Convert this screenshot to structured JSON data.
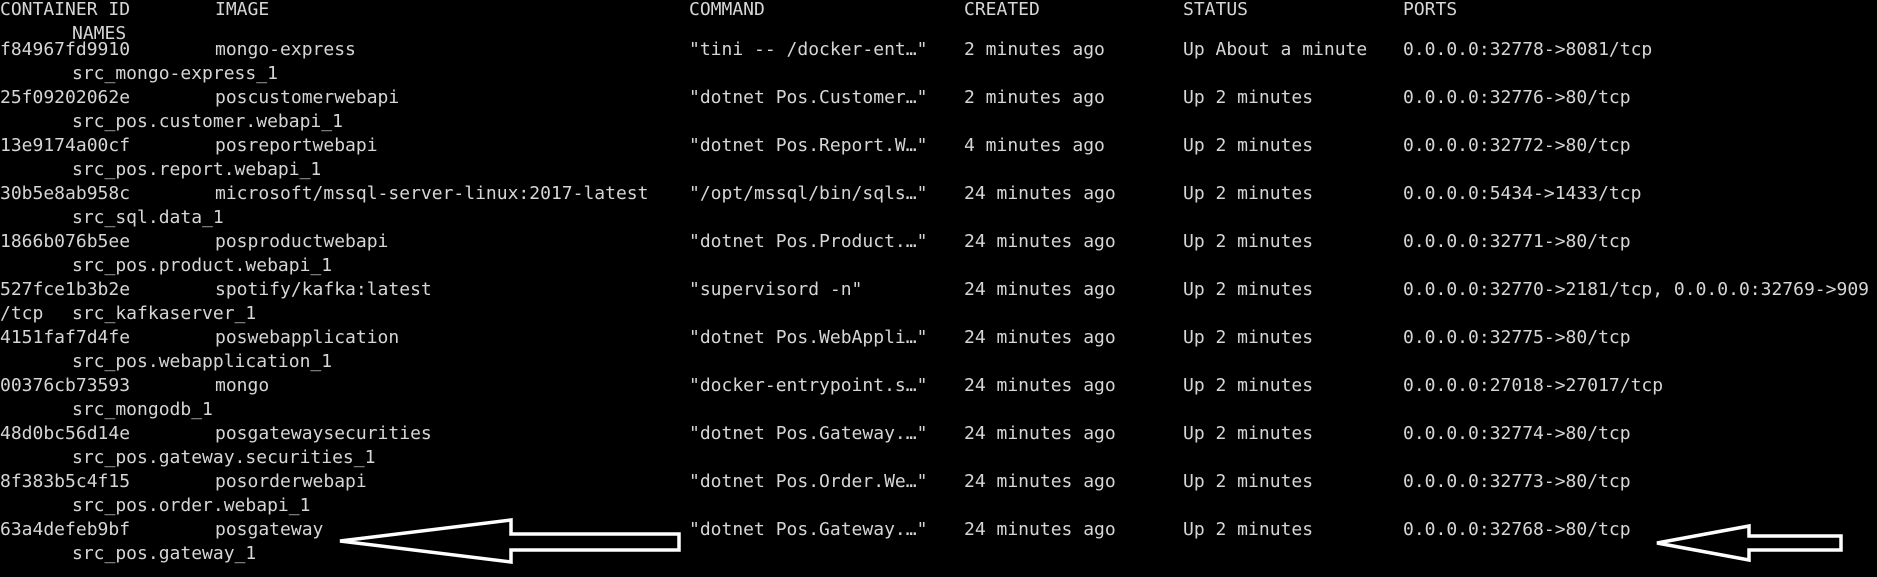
{
  "terminal": {
    "header": {
      "container_id": "CONTAINER ID",
      "image": "IMAGE",
      "command": "COMMAND",
      "created": "CREATED",
      "status": "STATUS",
      "ports": "PORTS",
      "names": "NAMES"
    },
    "rows": [
      {
        "id": "f84967fd9910",
        "image": "mongo-express",
        "command": "\"tini -- /docker-ent…\"",
        "created": "2 minutes ago",
        "status": "Up About a minute",
        "ports": "0.0.0.0:32778->8081/tcp",
        "name": "src_mongo-express_1"
      },
      {
        "id": "25f09202062e",
        "image": "poscustomerwebapi",
        "command": "\"dotnet Pos.Customer…\"",
        "created": "2 minutes ago",
        "status": "Up 2 minutes",
        "ports": "0.0.0.0:32776->80/tcp",
        "name": "src_pos.customer.webapi_1"
      },
      {
        "id": "13e9174a00cf",
        "image": "posreportwebapi",
        "command": "\"dotnet Pos.Report.W…\"",
        "created": "4 minutes ago",
        "status": "Up 2 minutes",
        "ports": "0.0.0.0:32772->80/tcp",
        "name": "src_pos.report.webapi_1"
      },
      {
        "id": "30b5e8ab958c",
        "image": "microsoft/mssql-server-linux:2017-latest",
        "command": "\"/opt/mssql/bin/sqls…\"",
        "created": "24 minutes ago",
        "status": "Up 2 minutes",
        "ports": "0.0.0.0:5434->1433/tcp",
        "name": "src_sql.data_1"
      },
      {
        "id": "1866b076b5ee",
        "image": "posproductwebapi",
        "command": "\"dotnet Pos.Product.…\"",
        "created": "24 minutes ago",
        "status": "Up 2 minutes",
        "ports": "0.0.0.0:32771->80/tcp",
        "name": "src_pos.product.webapi_1"
      },
      {
        "id": "527fce1b3b2e",
        "image": "spotify/kafka:latest",
        "command": "\"supervisord -n\"",
        "created": "24 minutes ago",
        "status": "Up 2 minutes",
        "ports": "0.0.0.0:32770->2181/tcp, 0.0.0.0:32769->909",
        "tail": "/tcp",
        "name": "src_kafkaserver_1"
      },
      {
        "id": "4151faf7d4fe",
        "image": "poswebapplication",
        "command": "\"dotnet Pos.WebAppli…\"",
        "created": "24 minutes ago",
        "status": "Up 2 minutes",
        "ports": "0.0.0.0:32775->80/tcp",
        "name": "src_pos.webapplication_1"
      },
      {
        "id": "00376cb73593",
        "image": "mongo",
        "command": "\"docker-entrypoint.s…\"",
        "created": "24 minutes ago",
        "status": "Up 2 minutes",
        "ports": "0.0.0.0:27018->27017/tcp",
        "name": "src_mongodb_1"
      },
      {
        "id": "48d0bc56d14e",
        "image": "posgatewaysecurities",
        "command": "\"dotnet Pos.Gateway.…\"",
        "created": "24 minutes ago",
        "status": "Up 2 minutes",
        "ports": "0.0.0.0:32774->80/tcp",
        "name": "src_pos.gateway.securities_1"
      },
      {
        "id": "8f383b5c4f15",
        "image": "posorderwebapi",
        "command": "\"dotnet Pos.Order.We…\"",
        "created": "24 minutes ago",
        "status": "Up 2 minutes",
        "ports": "0.0.0.0:32773->80/tcp",
        "name": "src_pos.order.webapi_1"
      },
      {
        "id": "63a4defeb9bf",
        "image": "posgateway",
        "command": "\"dotnet Pos.Gateway.…\"",
        "created": "24 minutes ago",
        "status": "Up 2 minutes",
        "ports": "0.0.0.0:32768->80/tcp",
        "name": "src_pos.gateway_1"
      }
    ]
  },
  "annotations": {
    "arrow_color": "#ffffff",
    "arrows": [
      "image-pointer-arrow",
      "ports-pointer-arrow"
    ]
  },
  "colors": {
    "background": "#000000",
    "text": "#d6d6d6"
  }
}
